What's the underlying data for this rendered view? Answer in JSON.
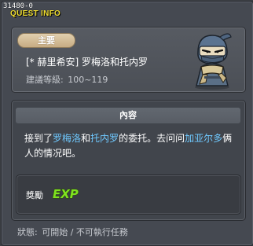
{
  "window": {
    "id": "31480-0",
    "title": "QUEST INFO"
  },
  "summary": {
    "badge": "主要",
    "quest_name": "[* 赫里希安] 罗梅洛和托内罗",
    "level_label": "建議等級:",
    "level_range": "100~119",
    "npc_icon": "masked-npc-portrait-icon"
  },
  "content": {
    "header": "內容",
    "description_parts": [
      {
        "text": "接到了",
        "highlight": false
      },
      {
        "text": "罗梅洛",
        "highlight": true
      },
      {
        "text": "和",
        "highlight": false
      },
      {
        "text": "托内罗",
        "highlight": true
      },
      {
        "text": "的委托。去问问",
        "highlight": false
      },
      {
        "text": "加亚尔多",
        "highlight": true
      },
      {
        "text": "俩人的情况吧。",
        "highlight": false
      }
    ],
    "highlight_color": "#6fc9ff"
  },
  "reward": {
    "label": "獎勵",
    "exp_text": "EXP",
    "exp_color": "#7fe21f"
  },
  "status": {
    "label": "狀態:",
    "value": "可開始 / 不可執行任務"
  }
}
